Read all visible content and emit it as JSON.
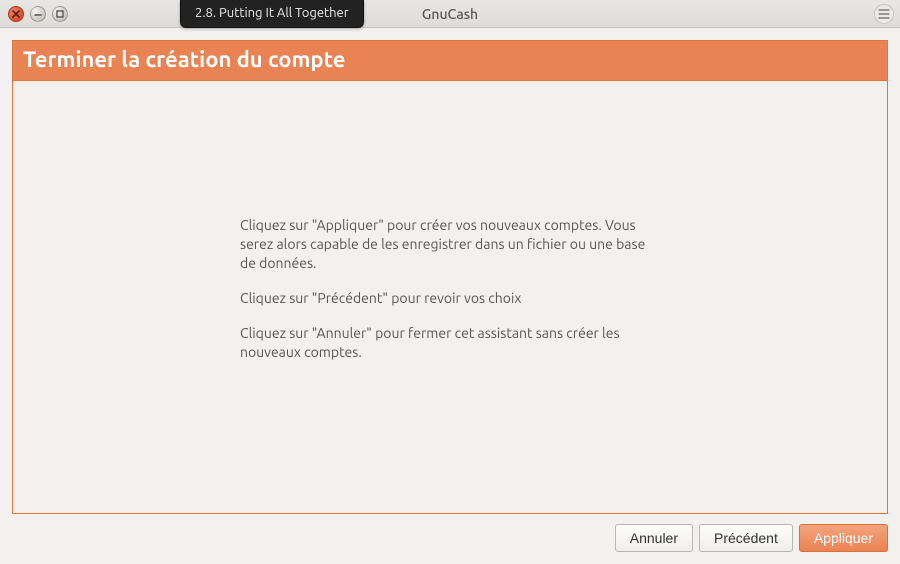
{
  "window": {
    "title": "GnuCash",
    "chapter_tag": "2.8. Putting It All Together"
  },
  "wizard": {
    "header": "Terminer la création du compte",
    "paragraphs": {
      "p1": "Cliquez sur \"Appliquer\" pour créer vos nouveaux comptes. Vous serez alors capable de les enregistrer dans un fichier ou une base de données.",
      "p2": "Cliquez sur \"Précédent\" pour revoir vos choix",
      "p3": "Cliquez sur \"Annuler\" pour fermer cet assistant sans créer les nouveaux comptes."
    }
  },
  "buttons": {
    "cancel": "Annuler",
    "back": "Précédent",
    "apply": "Appliquer"
  }
}
